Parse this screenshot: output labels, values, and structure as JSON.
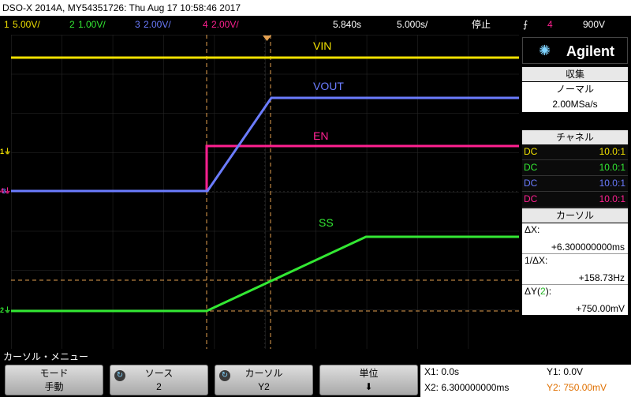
{
  "titlebar": {
    "text": "DSO-X 2014A, MY54351726: Thu Aug 17 10:58:46 2017"
  },
  "channels": [
    {
      "num": "1",
      "scale": "5.00V/",
      "color": "#f0e000"
    },
    {
      "num": "2",
      "scale": "1.00V/",
      "color": "#33e833"
    },
    {
      "num": "3",
      "scale": "2.00V/",
      "color": "#6b7cff"
    },
    {
      "num": "4",
      "scale": "2.00V/",
      "color": "#ff2090"
    }
  ],
  "timebase": {
    "delay": "5.840s",
    "scale": "5.000s/",
    "run_state": "停止",
    "trigger_source": "4",
    "trigger_level": "900V"
  },
  "trace_labels": {
    "vin": "VIN",
    "vout": "VOUT",
    "en": "EN",
    "ss": "SS"
  },
  "panel": {
    "brand": "Agilent",
    "acq_head": "収集",
    "acq_mode": "ノーマル",
    "acq_rate": "2.00MSa/s",
    "ch_head": "チャネル",
    "ch_rows": [
      {
        "coupling": "DC",
        "probe": "10.0:1",
        "color": "#f0e000"
      },
      {
        "coupling": "DC",
        "probe": "10.0:1",
        "color": "#33e833"
      },
      {
        "coupling": "DC",
        "probe": "10.0:1",
        "color": "#6b7cff"
      },
      {
        "coupling": "DC",
        "probe": "10.0:1",
        "color": "#ff2090"
      }
    ],
    "cursor_head": "カーソル",
    "dx_label": "ΔX:",
    "dx_value": "+6.300000000ms",
    "inv_dx_label": "1/ΔX:",
    "inv_dx_value": "+158.73Hz",
    "dy_label_pre": "ΔY(",
    "dy_label_ch": "2",
    "dy_label_post": "):",
    "dy_value": "+750.00mV"
  },
  "menu": {
    "title": "カーソル・メニュー",
    "softkeys": [
      {
        "label": "モード",
        "value": "手動"
      },
      {
        "label": "ソース",
        "value": "2"
      },
      {
        "label": "カーソル",
        "value": "Y2"
      },
      {
        "label": "単位",
        "value": "⬇"
      }
    ]
  },
  "readout": {
    "x1": "X1: 0.0s",
    "x2": "X2: 6.300000000ms",
    "y1": "Y1: 0.0V",
    "y2": "Y2: 750.00mV"
  }
}
